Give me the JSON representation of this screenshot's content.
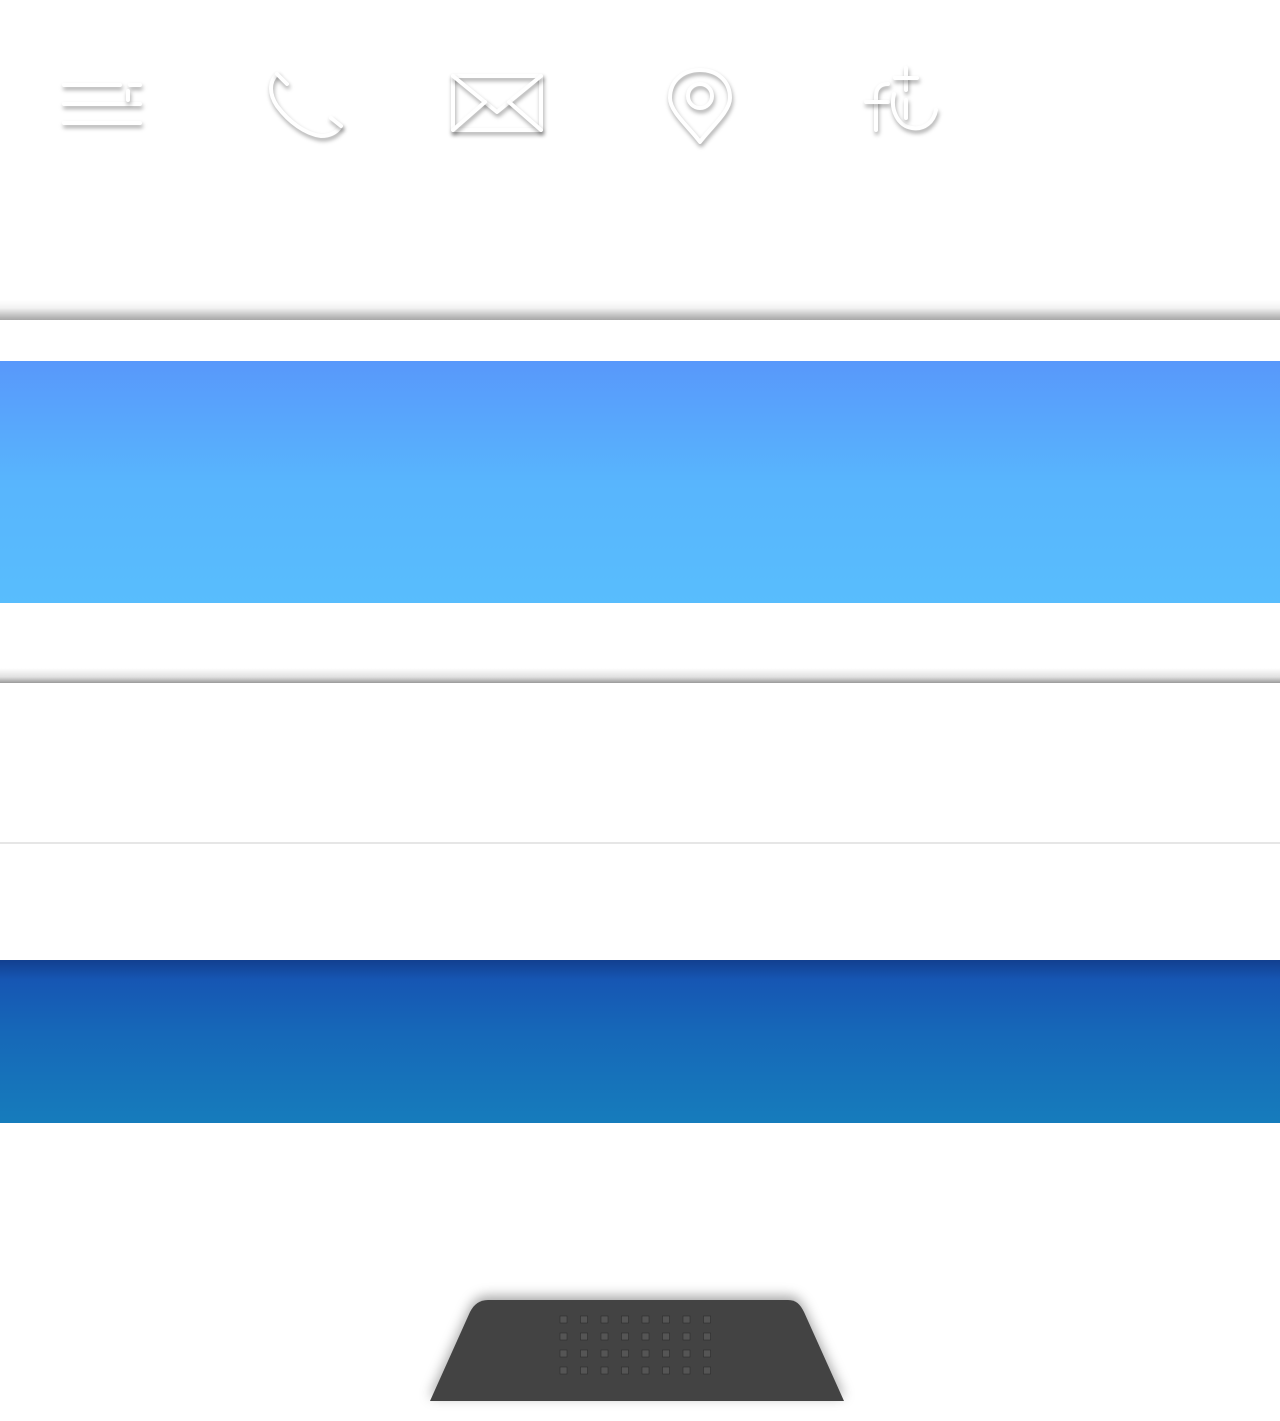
{
  "topbar": {
    "icons": [
      {
        "name": "menu-icon"
      },
      {
        "name": "phone-icon"
      },
      {
        "name": "mail-icon"
      },
      {
        "name": "location-pin-icon"
      },
      {
        "name": "social-add-icon"
      }
    ]
  },
  "colors": {
    "background": "#ffffff",
    "light_band_top": "#5898fb",
    "light_band_bottom": "#58bdfd",
    "dark_band_top": "#1656b3",
    "dark_band_bottom": "#167cbc",
    "speaker": "#434343"
  }
}
